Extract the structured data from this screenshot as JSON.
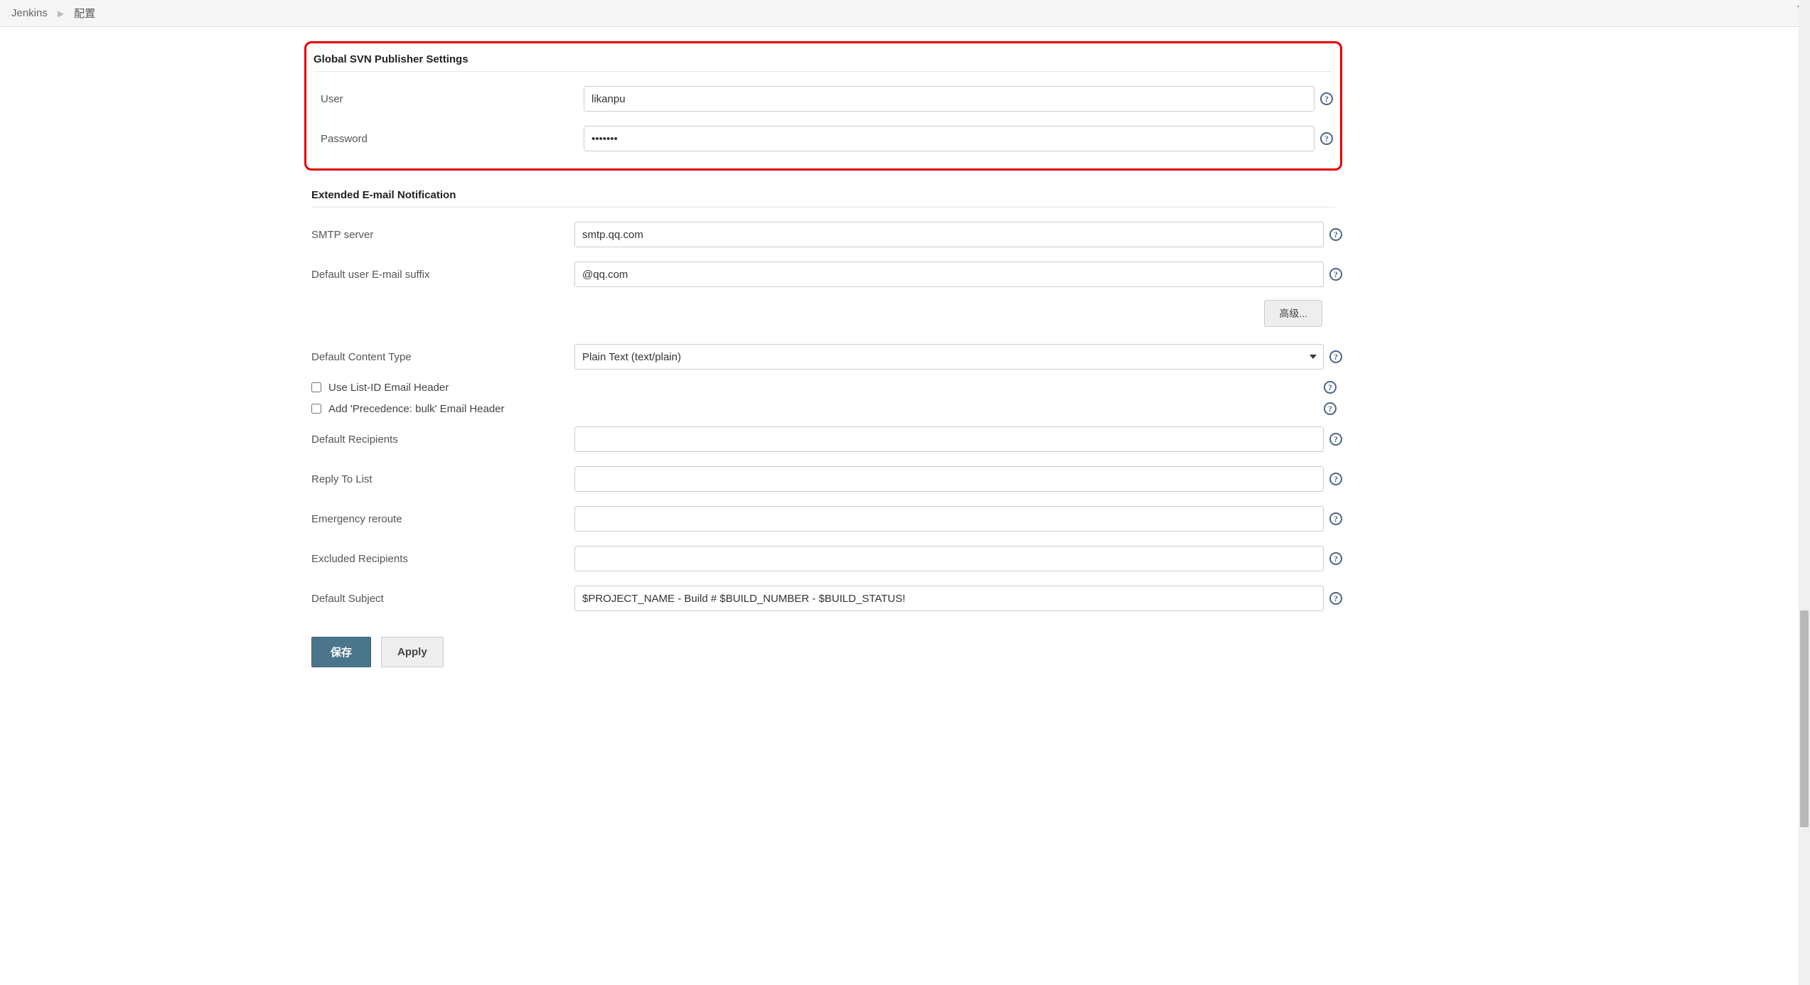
{
  "breadcrumb": {
    "root": "Jenkins",
    "current": "配置"
  },
  "svn": {
    "section_title": "Global SVN Publisher Settings",
    "user_label": "User",
    "user_value": "likanpu",
    "password_label": "Password",
    "password_value": "•••••••"
  },
  "email": {
    "section_title": "Extended E-mail Notification",
    "smtp_label": "SMTP server",
    "smtp_value": "smtp.qq.com",
    "suffix_label": "Default user E-mail suffix",
    "suffix_value": "@qq.com",
    "advanced_label": "高级...",
    "content_type_label": "Default Content Type",
    "content_type_value": "Plain Text (text/plain)",
    "use_listid_label": "Use List-ID Email Header",
    "precedence_label": "Add 'Precedence: bulk' Email Header",
    "default_recipients_label": "Default Recipients",
    "default_recipients_value": "",
    "reply_to_label": "Reply To List",
    "reply_to_value": "",
    "emergency_label": "Emergency reroute",
    "emergency_value": "",
    "excluded_label": "Excluded Recipients",
    "excluded_value": "",
    "subject_label": "Default Subject",
    "subject_value": "$PROJECT_NAME - Build # $BUILD_NUMBER - $BUILD_STATUS!"
  },
  "buttons": {
    "save": "保存",
    "apply": "Apply"
  }
}
